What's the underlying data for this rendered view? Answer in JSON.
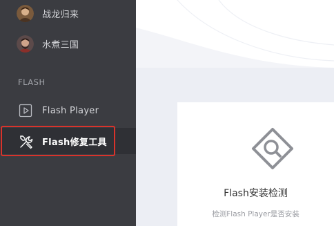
{
  "sidebar": {
    "items": [
      {
        "label": "战龙归来"
      },
      {
        "label": "水煮三国"
      }
    ],
    "section_title": "FLASH",
    "flash_items": [
      {
        "label": "Flash Player",
        "icon": "play-icon"
      },
      {
        "label": "Flash修复工具",
        "icon": "tools-icon"
      }
    ]
  },
  "main": {
    "card": {
      "title": "Flash安装检测",
      "subtitle": "检测Flash Player是否安装"
    }
  },
  "colors": {
    "sidebar_bg": "#3b3c41",
    "active_bg": "#2f3035",
    "highlight": "#d9332b",
    "main_bg": "#eceef4"
  }
}
